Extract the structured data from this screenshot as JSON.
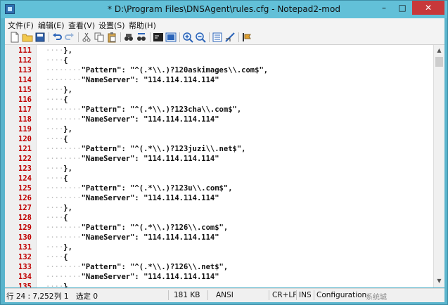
{
  "window": {
    "title": "* D:\\Program Files\\DNSAgent\\rules.cfg - Notepad2-mod",
    "minimize": "–",
    "maximize": "□",
    "close": "✕"
  },
  "menu": [
    "文件(F)",
    "编辑(E)",
    "查看(V)",
    "设置(S)",
    "帮助(H)"
  ],
  "toolbar": [
    "new-icon",
    "open-icon",
    "save-icon",
    "undo-icon",
    "redo-icon",
    "cut-icon",
    "copy-icon",
    "paste-icon",
    "find-icon",
    "replace-icon",
    "word-wrap-icon",
    "view-icon",
    "zoom-in-icon",
    "zoom-out-icon",
    "settings-icon",
    "scheme-icon",
    "always-on-top-icon"
  ],
  "editor": {
    "lines": [
      {
        "n": "111",
        "indent": "····",
        "text": "},"
      },
      {
        "n": "112",
        "indent": "····",
        "text": "{"
      },
      {
        "n": "113",
        "indent": "········",
        "text": "\"Pattern\": \"^(.*\\\\.)?120askimages\\\\.com$\","
      },
      {
        "n": "114",
        "indent": "········",
        "text": "\"NameServer\": \"114.114.114.114\""
      },
      {
        "n": "115",
        "indent": "····",
        "text": "},"
      },
      {
        "n": "116",
        "indent": "····",
        "text": "{"
      },
      {
        "n": "117",
        "indent": "········",
        "text": "\"Pattern\": \"^(.*\\\\.)?123cha\\\\.com$\","
      },
      {
        "n": "118",
        "indent": "········",
        "text": "\"NameServer\": \"114.114.114.114\""
      },
      {
        "n": "119",
        "indent": "····",
        "text": "},"
      },
      {
        "n": "120",
        "indent": "····",
        "text": "{"
      },
      {
        "n": "121",
        "indent": "········",
        "text": "\"Pattern\": \"^(.*\\\\.)?123juzi\\\\.net$\","
      },
      {
        "n": "122",
        "indent": "········",
        "text": "\"NameServer\": \"114.114.114.114\""
      },
      {
        "n": "123",
        "indent": "····",
        "text": "},"
      },
      {
        "n": "124",
        "indent": "····",
        "text": "{"
      },
      {
        "n": "125",
        "indent": "········",
        "text": "\"Pattern\": \"^(.*\\\\.)?123u\\\\.com$\","
      },
      {
        "n": "126",
        "indent": "········",
        "text": "\"NameServer\": \"114.114.114.114\""
      },
      {
        "n": "127",
        "indent": "····",
        "text": "},"
      },
      {
        "n": "128",
        "indent": "····",
        "text": "{"
      },
      {
        "n": "129",
        "indent": "········",
        "text": "\"Pattern\": \"^(.*\\\\.)?126\\\\.com$\","
      },
      {
        "n": "130",
        "indent": "········",
        "text": "\"NameServer\": \"114.114.114.114\""
      },
      {
        "n": "131",
        "indent": "····",
        "text": "},"
      },
      {
        "n": "132",
        "indent": "····",
        "text": "{"
      },
      {
        "n": "133",
        "indent": "········",
        "text": "\"Pattern\": \"^(.*\\\\.)?126\\\\.net$\","
      },
      {
        "n": "134",
        "indent": "········",
        "text": "\"NameServer\": \"114.114.114.114\""
      },
      {
        "n": "135",
        "indent": "····",
        "text": "},"
      }
    ]
  },
  "status": {
    "position": "行 24 : 7,252",
    "column": "列 1",
    "selection": "选定 0",
    "size": "181 KB",
    "encoding": "ANSI",
    "line_ending": "CR+LF",
    "mode": "INS",
    "scheme": "Configuration",
    "watermark": "系统城"
  },
  "colors": {
    "line_number": "#c00000",
    "close_button": "#c7383a",
    "titlebar": "#62c0d8"
  }
}
